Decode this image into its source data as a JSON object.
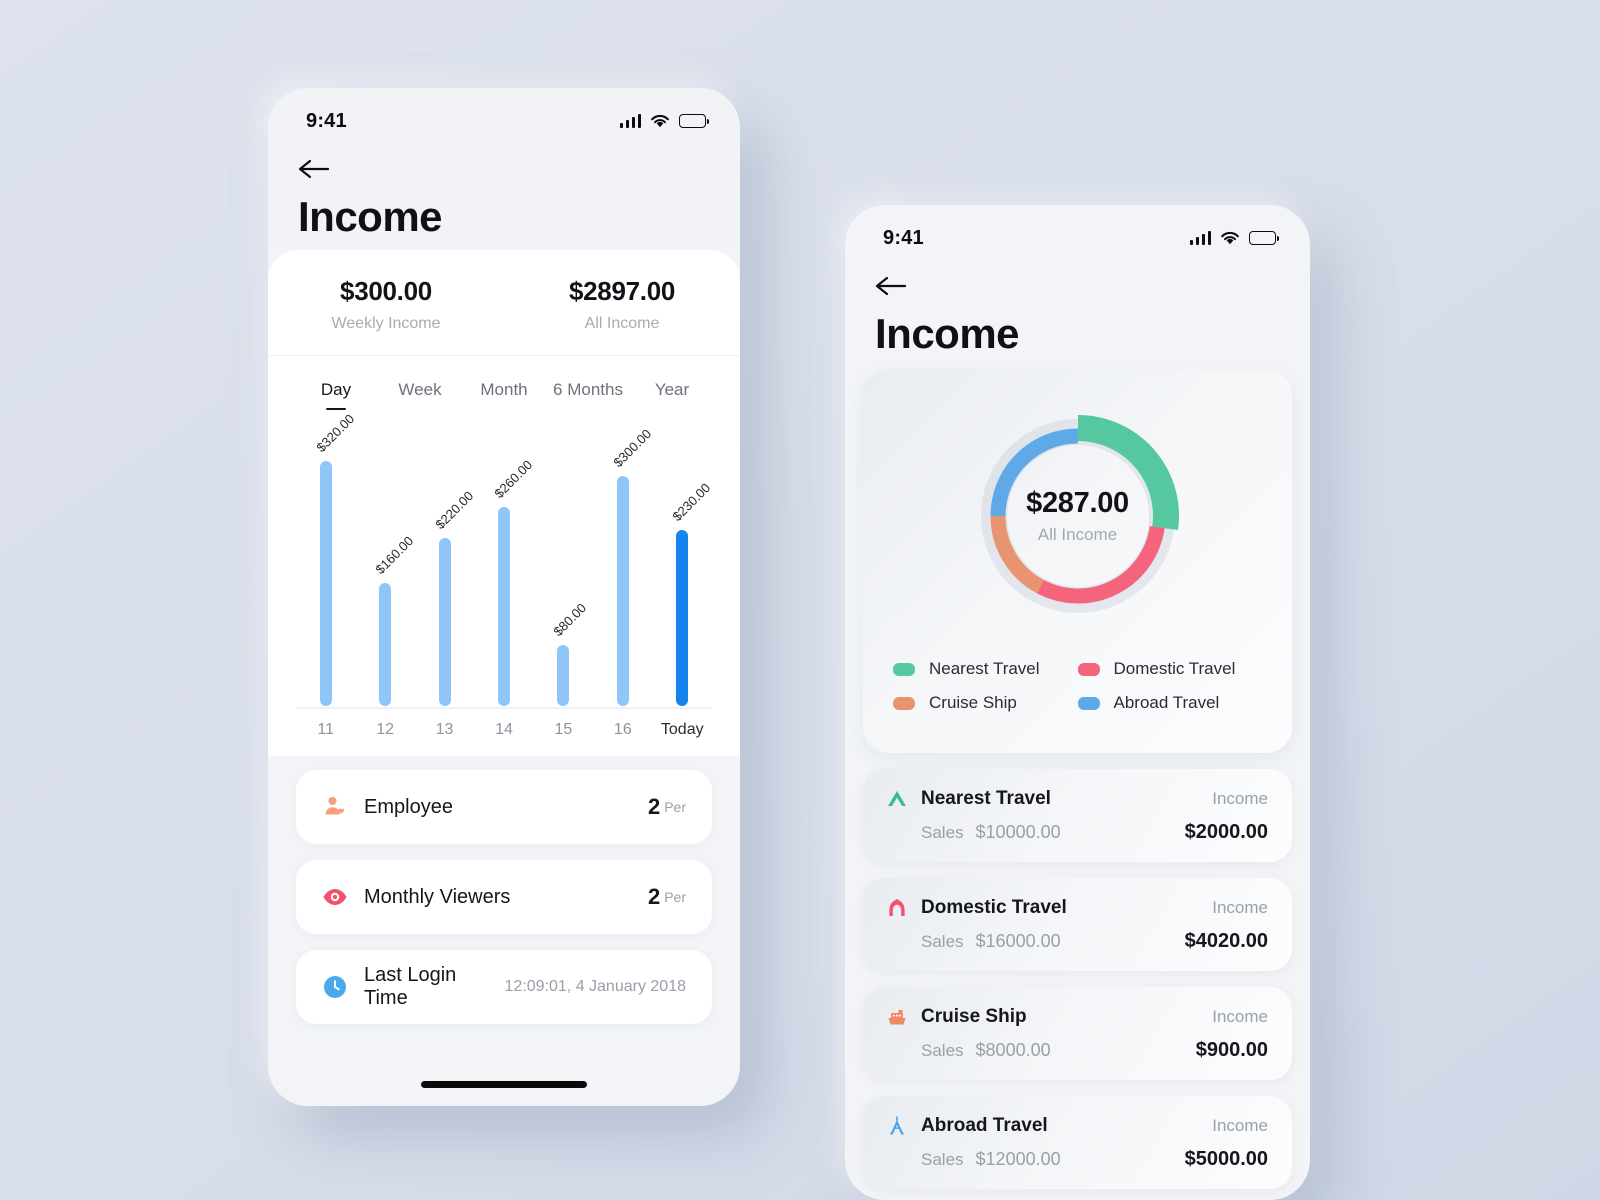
{
  "canvas": {
    "background_color": "#dce1ec"
  },
  "phone_one": {
    "status_bar": {
      "time": "9:41",
      "signal_icon": "cellular-bars-icon",
      "wifi_icon": "wifi-icon",
      "battery_icon": "battery-icon"
    },
    "header": {
      "back_icon": "back-arrow-icon",
      "title": "Income"
    },
    "summary": [
      {
        "value": "$300.00",
        "label": "Weekly Income"
      },
      {
        "value": "$2897.00",
        "label": "All Income"
      }
    ],
    "tabs": [
      {
        "label": "Day",
        "active": true
      },
      {
        "label": "Week",
        "active": false
      },
      {
        "label": "Month",
        "active": false
      },
      {
        "label": "6 Months",
        "active": false
      },
      {
        "label": "Year",
        "active": false
      }
    ],
    "list": [
      {
        "icon": "employee-person-heart-icon",
        "icon_color": "#f6a17a",
        "title": "Employee",
        "value": "2",
        "unit": "Per"
      },
      {
        "icon": "eye-icon",
        "icon_color": "#f4516c",
        "title": "Monthly Viewers",
        "value": "2",
        "unit": "Per"
      },
      {
        "icon": "clock-circle-icon",
        "icon_color": "#4ba8ef",
        "title": "Last Login Time",
        "meta": "12:09:01, 4 January 2018"
      }
    ],
    "home_indicator": "home-indicator"
  },
  "phone_two": {
    "status_bar": {
      "time": "9:41",
      "signal_icon": "cellular-bars-icon",
      "wifi_icon": "wifi-icon",
      "battery_icon": "battery-icon"
    },
    "header": {
      "back_icon": "back-arrow-icon",
      "title": "Income"
    },
    "donut": {
      "center_value": "$287.00",
      "center_label": "All Income"
    },
    "legend": [
      {
        "label": "Nearest Travel",
        "color": "#55c8a0"
      },
      {
        "label": "Domestic Travel",
        "color": "#f4647d"
      },
      {
        "label": "Cruise Ship",
        "color": "#e89470"
      },
      {
        "label": "Abroad Travel",
        "color": "#5fa9e8"
      }
    ],
    "travel_rows": [
      {
        "icon": "mountain-icon",
        "icon_color": "#3cbb8e",
        "name": "Nearest Travel",
        "income_label": "Income",
        "sales_key": "Sales",
        "sales_value": "$10000.00",
        "income_value": "$2000.00"
      },
      {
        "icon": "bridge-arch-icon",
        "icon_color": "#f4516c",
        "name": "Domestic Travel",
        "income_label": "Income",
        "sales_key": "Sales",
        "sales_value": "$16000.00",
        "income_value": "$4020.00"
      },
      {
        "icon": "ship-icon",
        "icon_color": "#ed8a64",
        "name": "Cruise Ship",
        "income_label": "Income",
        "sales_key": "Sales",
        "sales_value": "$8000.00",
        "income_value": "$900.00"
      },
      {
        "icon": "eiffel-tower-icon",
        "icon_color": "#4ba0e8",
        "name": "Abroad Travel",
        "income_label": "Income",
        "sales_key": "Sales",
        "sales_value": "$12000.00",
        "income_value": "$5000.00"
      }
    ]
  },
  "chart_data": [
    {
      "type": "bar",
      "title": "",
      "xlabel": "",
      "ylabel": "",
      "categories": [
        "11",
        "12",
        "13",
        "14",
        "15",
        "16",
        "Today"
      ],
      "values": [
        320,
        160,
        220,
        260,
        80,
        300,
        230
      ],
      "value_labels": [
        "$320.00",
        "$160.00",
        "$220.00",
        "$260.00",
        "$80.00",
        "$300.00",
        "$230.00"
      ],
      "ylim": [
        0,
        320
      ],
      "grid": false,
      "legend": "none",
      "bar_color": "#8fc5f8",
      "highlight_index": 6,
      "highlight_color": "#1683ef"
    },
    {
      "type": "pie",
      "title": "",
      "center_text": "$287.00",
      "center_subtext": "All Income",
      "labels": [
        "Nearest Travel",
        "Domestic Travel",
        "Cruise Ship",
        "Abroad Travel"
      ],
      "values": [
        2000,
        4020,
        900,
        5000
      ],
      "slice_degrees": [
        98,
        110,
        62,
        90
      ],
      "colors": [
        "#55c8a0",
        "#f4647d",
        "#e89470",
        "#5fa9e8"
      ],
      "legend": "bottom",
      "donut": true
    }
  ]
}
